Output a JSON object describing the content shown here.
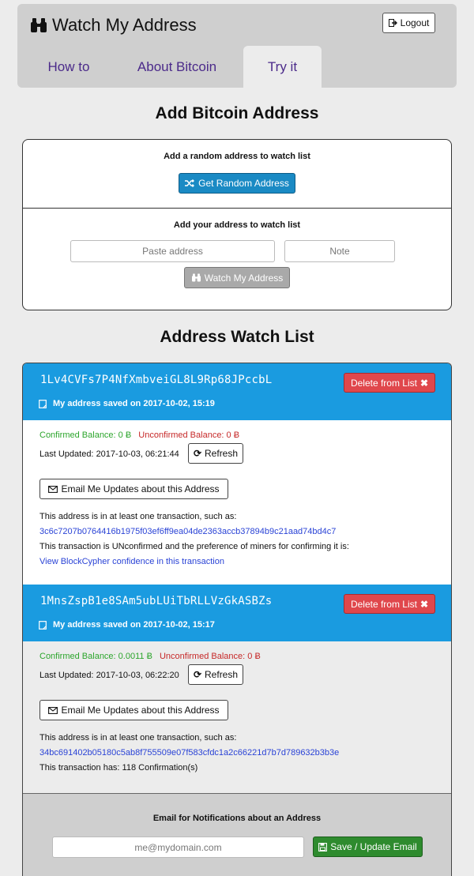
{
  "app": {
    "title": "Watch My Address",
    "logout_label": "Logout",
    "tabs": [
      {
        "label": "How to",
        "active": false
      },
      {
        "label": "About Bitcoin",
        "active": false
      },
      {
        "label": "Try it",
        "active": true
      }
    ]
  },
  "add_section": {
    "title": "Add Bitcoin Address",
    "random_label": "Add a random address to watch list",
    "random_button": "Get Random Address",
    "own_label": "Add your address to watch list",
    "address_placeholder": "Paste address",
    "note_placeholder": "Note",
    "watch_button": "Watch My Address"
  },
  "watch_list": {
    "title": "Address Watch List",
    "delete_label": "Delete from List",
    "refresh_label": "Refresh",
    "email_updates_label": "Email Me Updates about this Address",
    "confirmed_prefix": "Confirmed Balance: ",
    "unconfirmed_prefix": "Unconfirmed Balance: ",
    "currency_symbol": "Ƀ",
    "last_updated_prefix": "Last Updated: ",
    "tx_intro": "This address is in at least one transaction, such as:",
    "entries": [
      {
        "address": "1Lv4CVFs7P4NfXmbveiGL8L9Rp68JPccbL",
        "saved": "My address saved on 2017-10-02, 15:19",
        "confirmed": "0",
        "unconfirmed": "0",
        "last_updated": "2017-10-03, 06:21:44",
        "tx_hash": "3c6c7207b0764416b1975f03ef6ff9ea04de2363accb37894b9c21aad74bd4c7",
        "status_text": "This transaction is UNconfirmed and the preference of miners for confirming it is:",
        "confidence_link": "View BlockCypher confidence in this transaction"
      },
      {
        "address": "1MnsZspB1e8SAm5ubLUiTbRLLVzGkASBZs",
        "saved": "My address saved on 2017-10-02, 15:17",
        "confirmed": "0.0011",
        "unconfirmed": "0",
        "last_updated": "2017-10-03, 06:22:20",
        "tx_hash": "34bc691402b05180c5ab8f755509e07f583cfdc1a2c66221d7b7d789632b3b3e",
        "status_text": "This transaction has: 118 Confirmation(s)"
      }
    ]
  },
  "email": {
    "label": "Email for Notifications about an Address",
    "placeholder": "me@mydomain.com",
    "save_button": "Save / Update Email"
  }
}
